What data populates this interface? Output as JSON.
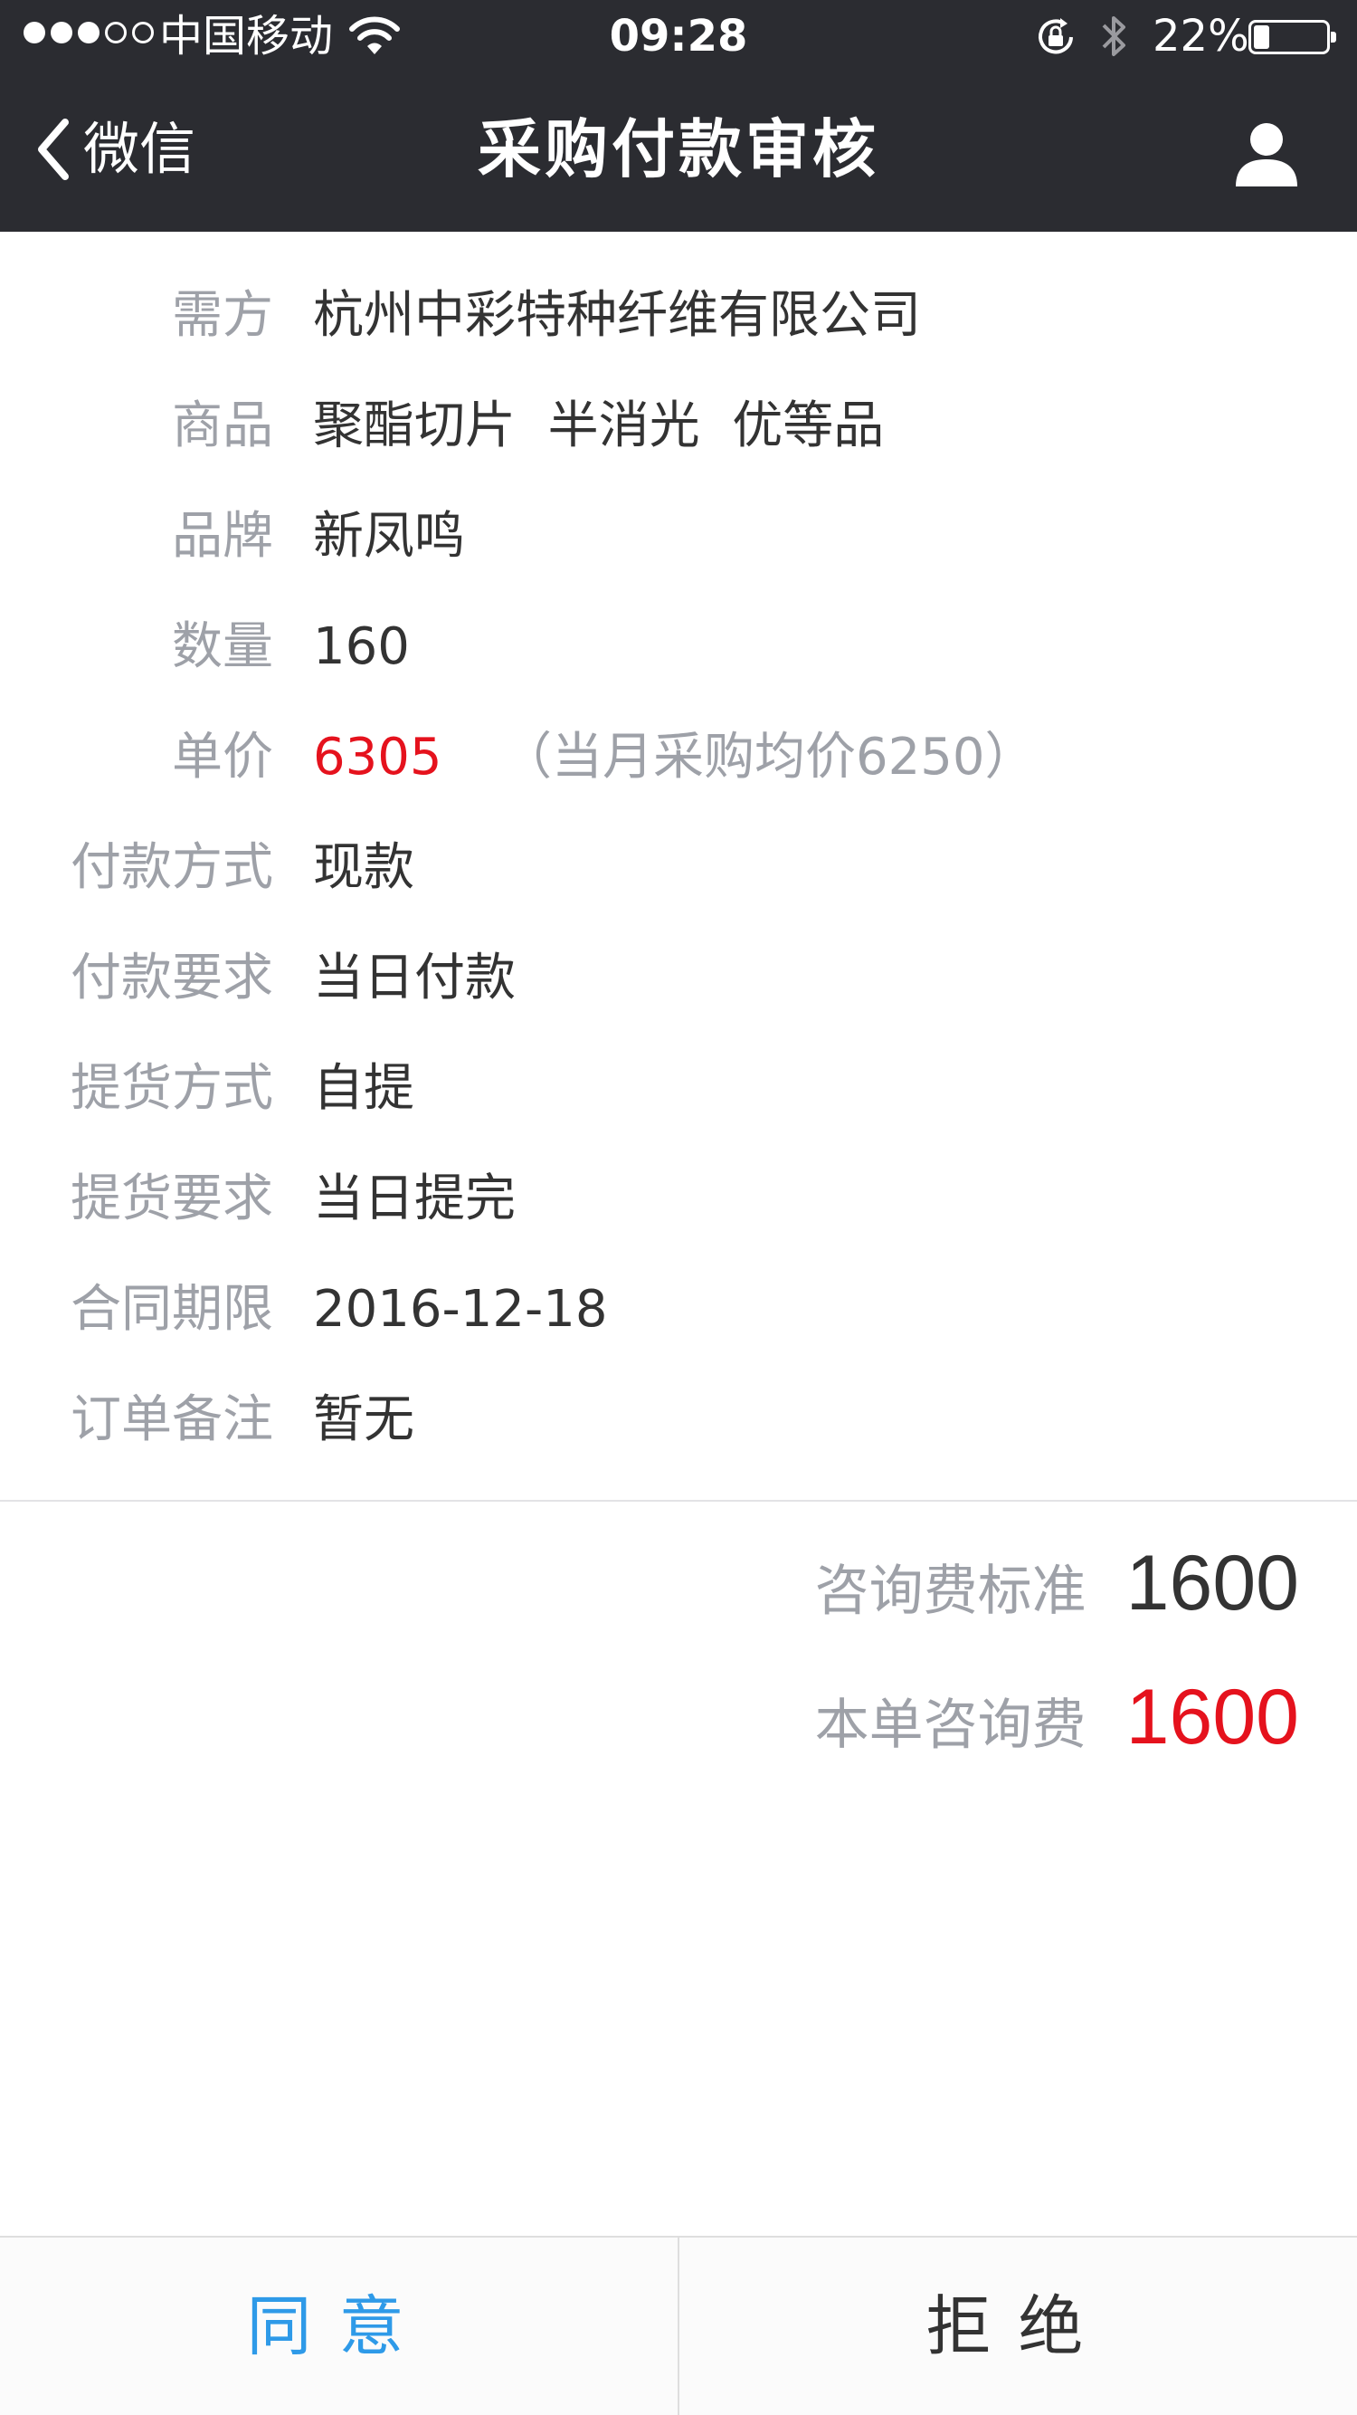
{
  "status_bar": {
    "carrier": "中国移动",
    "time": "09:28",
    "battery_text": "22%",
    "battery_level": 0.22,
    "signal_bars_filled": 3,
    "signal_bars_total": 5
  },
  "nav": {
    "back_label": "微信",
    "title": "采购付款审核"
  },
  "details": [
    {
      "label": "需方",
      "value": "杭州中彩特种纤维有限公司"
    },
    {
      "label": "商品",
      "value": "聚酯切片  半消光  优等品"
    },
    {
      "label": "品牌",
      "value": "新凤鸣"
    },
    {
      "label": "数量",
      "value": "160"
    },
    {
      "label": "单价",
      "value": "6305",
      "note": "（当月采购均价6250）"
    },
    {
      "label": "付款方式",
      "value": "现款"
    },
    {
      "label": "付款要求",
      "value": "当日付款"
    },
    {
      "label": "提货方式",
      "value": "自提"
    },
    {
      "label": "提货要求",
      "value": "当日提完"
    },
    {
      "label": "合同期限",
      "value": "2016-12-18"
    },
    {
      "label": "订单备注",
      "value": "暂无"
    }
  ],
  "fees": {
    "standard_label": "咨询费标准",
    "standard_value": "1600",
    "order_label": "本单咨询费",
    "order_value": "1600"
  },
  "actions": {
    "agree": "同意",
    "reject": "拒绝"
  },
  "colors": {
    "nav_background": "#2b2c31",
    "label_gray": "#9ea1a8",
    "value_dark": "#333333",
    "highlight_red": "#e5121d",
    "agree_blue": "#2e9ae8"
  }
}
